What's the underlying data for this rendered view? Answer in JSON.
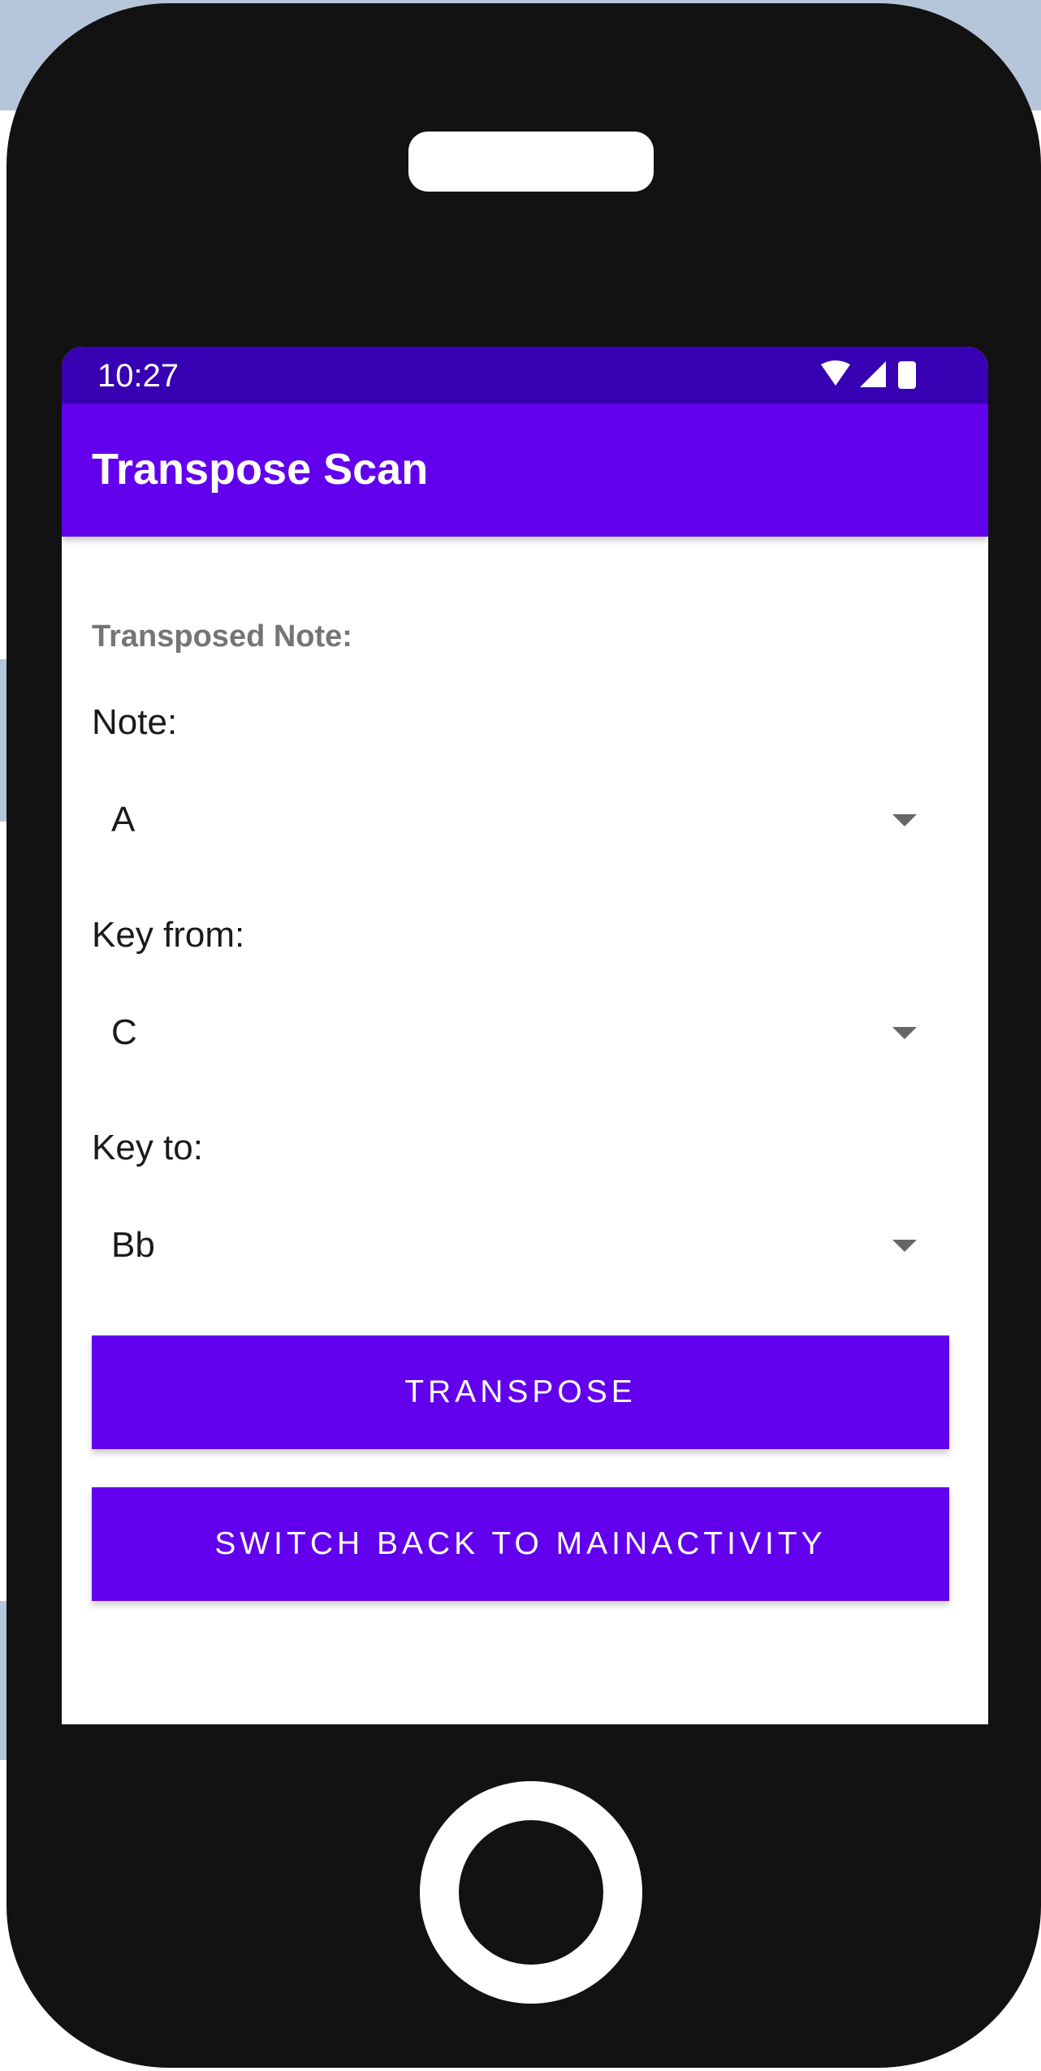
{
  "status_bar": {
    "time": "10:27",
    "icons": [
      "wifi-icon",
      "cell-signal-icon",
      "battery-icon"
    ]
  },
  "app_bar": {
    "title": "Transpose Scan"
  },
  "content": {
    "result_label": "Transposed Note:",
    "note": {
      "label": "Note:",
      "selected": "A"
    },
    "key_from": {
      "label": "Key from:",
      "selected": "C"
    },
    "key_to": {
      "label": "Key to:",
      "selected": "Bb"
    },
    "transpose_button": "TRANSPOSE",
    "switch_button": "SWITCH BACK TO MAINACTIVITY"
  },
  "colors": {
    "status_bar": "#3700b3",
    "primary": "#6200ee",
    "phone_body": "#121212",
    "background_band": "#b6c6da"
  }
}
